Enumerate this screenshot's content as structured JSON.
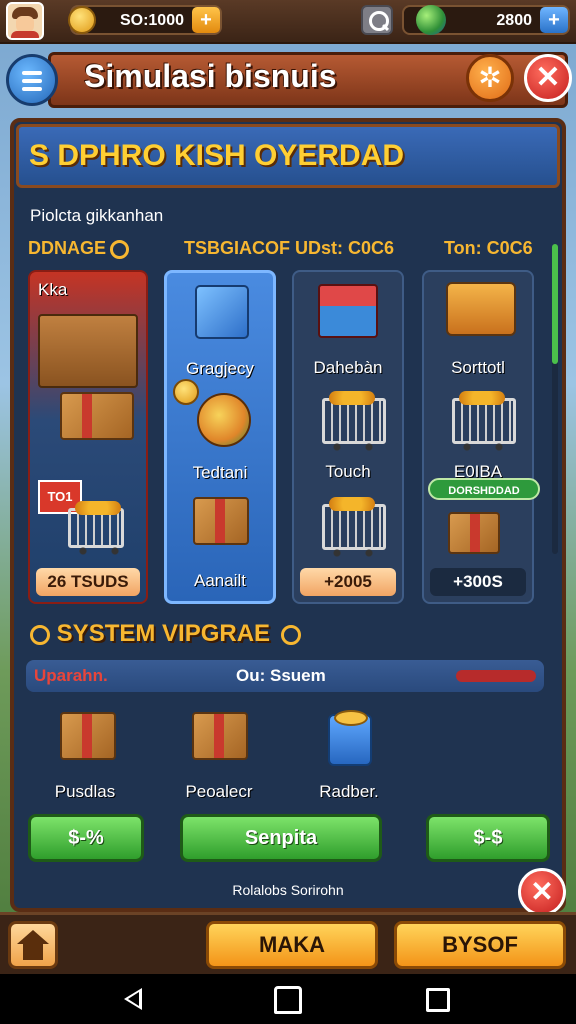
{
  "topbar": {
    "coins": "SO:1000",
    "gems": "2800"
  },
  "header": {
    "title": "Simulasi bisnuis"
  },
  "panel": {
    "banner": "S DPHRO  KISH OYERDAD",
    "subtitle": "Piolcta gikkanhan",
    "col_headers": [
      "DDNAGE",
      "TSBGIACOF UDst: C0C6",
      "Ton: C0C6"
    ],
    "cards": [
      {
        "top_label": "Kka",
        "footer": "26 TSUDS"
      },
      {
        "labels": [
          "Gragjecy",
          "Tedtani",
          "Aanailt"
        ]
      },
      {
        "labels": [
          "Dahebàn",
          "Touch"
        ],
        "footer": "+2005"
      },
      {
        "labels": [
          "Sorttotl",
          "E0IBA"
        ],
        "tag": "DORSHDDAD",
        "footer": "+300S"
      }
    ],
    "sign_text": "TO1",
    "system_title": "SYSTEM VIPGRAE",
    "upgrade_bar": {
      "left": "Uparahn.",
      "mid": "Ou: Ssuem"
    },
    "items": [
      "Pusdlas",
      "Peoalecr",
      "Radber."
    ],
    "buttons": [
      "$-%",
      "Senpita",
      "$-$"
    ],
    "footer": "Rolalobs Sorirohn"
  },
  "bottom": {
    "btn1": "MAKA",
    "btn2": "BYSOF"
  },
  "colors": {
    "accent": "#f7b731",
    "panel": "#1f3350",
    "wood": "#7d3519",
    "green": "#2f9e2c"
  }
}
